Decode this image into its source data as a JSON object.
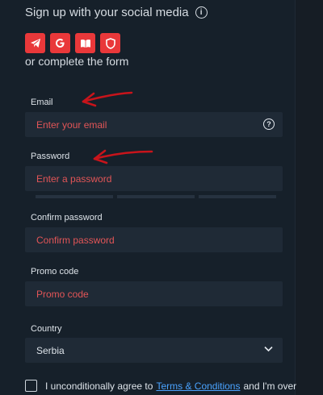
{
  "social": {
    "title": "Sign up with your social media",
    "buttons": [
      "telegram",
      "google",
      "book",
      "shield"
    ],
    "alt_text": "or complete the form"
  },
  "fields": {
    "email": {
      "label": "Email",
      "placeholder": "Enter your email"
    },
    "password": {
      "label": "Password",
      "placeholder": "Enter a password"
    },
    "confirm": {
      "label": "Confirm password",
      "placeholder": "Confirm password"
    },
    "promo": {
      "label": "Promo code",
      "placeholder": "Promo code"
    },
    "country": {
      "label": "Country",
      "value": "Serbia"
    }
  },
  "agree": {
    "prefix": "I unconditionally agree to",
    "link": "Terms & Conditions",
    "suffix": "and I'm over"
  },
  "colors": {
    "accent": "#e9383a",
    "placeholder": "#e25557",
    "link": "#4aa3ff",
    "background": "#16202a",
    "field": "#1f2a36"
  }
}
